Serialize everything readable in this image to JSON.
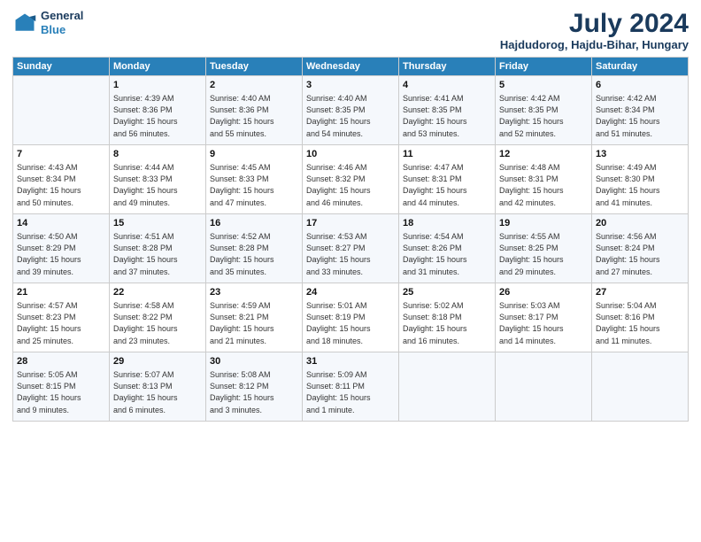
{
  "header": {
    "logo_line1": "General",
    "logo_line2": "Blue",
    "title": "July 2024",
    "subtitle": "Hajdudorog, Hajdu-Bihar, Hungary"
  },
  "days_of_week": [
    "Sunday",
    "Monday",
    "Tuesday",
    "Wednesday",
    "Thursday",
    "Friday",
    "Saturday"
  ],
  "weeks": [
    [
      {
        "day": "",
        "lines": []
      },
      {
        "day": "1",
        "lines": [
          "Sunrise: 4:39 AM",
          "Sunset: 8:36 PM",
          "Daylight: 15 hours",
          "and 56 minutes."
        ]
      },
      {
        "day": "2",
        "lines": [
          "Sunrise: 4:40 AM",
          "Sunset: 8:36 PM",
          "Daylight: 15 hours",
          "and 55 minutes."
        ]
      },
      {
        "day": "3",
        "lines": [
          "Sunrise: 4:40 AM",
          "Sunset: 8:35 PM",
          "Daylight: 15 hours",
          "and 54 minutes."
        ]
      },
      {
        "day": "4",
        "lines": [
          "Sunrise: 4:41 AM",
          "Sunset: 8:35 PM",
          "Daylight: 15 hours",
          "and 53 minutes."
        ]
      },
      {
        "day": "5",
        "lines": [
          "Sunrise: 4:42 AM",
          "Sunset: 8:35 PM",
          "Daylight: 15 hours",
          "and 52 minutes."
        ]
      },
      {
        "day": "6",
        "lines": [
          "Sunrise: 4:42 AM",
          "Sunset: 8:34 PM",
          "Daylight: 15 hours",
          "and 51 minutes."
        ]
      }
    ],
    [
      {
        "day": "7",
        "lines": [
          "Sunrise: 4:43 AM",
          "Sunset: 8:34 PM",
          "Daylight: 15 hours",
          "and 50 minutes."
        ]
      },
      {
        "day": "8",
        "lines": [
          "Sunrise: 4:44 AM",
          "Sunset: 8:33 PM",
          "Daylight: 15 hours",
          "and 49 minutes."
        ]
      },
      {
        "day": "9",
        "lines": [
          "Sunrise: 4:45 AM",
          "Sunset: 8:33 PM",
          "Daylight: 15 hours",
          "and 47 minutes."
        ]
      },
      {
        "day": "10",
        "lines": [
          "Sunrise: 4:46 AM",
          "Sunset: 8:32 PM",
          "Daylight: 15 hours",
          "and 46 minutes."
        ]
      },
      {
        "day": "11",
        "lines": [
          "Sunrise: 4:47 AM",
          "Sunset: 8:31 PM",
          "Daylight: 15 hours",
          "and 44 minutes."
        ]
      },
      {
        "day": "12",
        "lines": [
          "Sunrise: 4:48 AM",
          "Sunset: 8:31 PM",
          "Daylight: 15 hours",
          "and 42 minutes."
        ]
      },
      {
        "day": "13",
        "lines": [
          "Sunrise: 4:49 AM",
          "Sunset: 8:30 PM",
          "Daylight: 15 hours",
          "and 41 minutes."
        ]
      }
    ],
    [
      {
        "day": "14",
        "lines": [
          "Sunrise: 4:50 AM",
          "Sunset: 8:29 PM",
          "Daylight: 15 hours",
          "and 39 minutes."
        ]
      },
      {
        "day": "15",
        "lines": [
          "Sunrise: 4:51 AM",
          "Sunset: 8:28 PM",
          "Daylight: 15 hours",
          "and 37 minutes."
        ]
      },
      {
        "day": "16",
        "lines": [
          "Sunrise: 4:52 AM",
          "Sunset: 8:28 PM",
          "Daylight: 15 hours",
          "and 35 minutes."
        ]
      },
      {
        "day": "17",
        "lines": [
          "Sunrise: 4:53 AM",
          "Sunset: 8:27 PM",
          "Daylight: 15 hours",
          "and 33 minutes."
        ]
      },
      {
        "day": "18",
        "lines": [
          "Sunrise: 4:54 AM",
          "Sunset: 8:26 PM",
          "Daylight: 15 hours",
          "and 31 minutes."
        ]
      },
      {
        "day": "19",
        "lines": [
          "Sunrise: 4:55 AM",
          "Sunset: 8:25 PM",
          "Daylight: 15 hours",
          "and 29 minutes."
        ]
      },
      {
        "day": "20",
        "lines": [
          "Sunrise: 4:56 AM",
          "Sunset: 8:24 PM",
          "Daylight: 15 hours",
          "and 27 minutes."
        ]
      }
    ],
    [
      {
        "day": "21",
        "lines": [
          "Sunrise: 4:57 AM",
          "Sunset: 8:23 PM",
          "Daylight: 15 hours",
          "and 25 minutes."
        ]
      },
      {
        "day": "22",
        "lines": [
          "Sunrise: 4:58 AM",
          "Sunset: 8:22 PM",
          "Daylight: 15 hours",
          "and 23 minutes."
        ]
      },
      {
        "day": "23",
        "lines": [
          "Sunrise: 4:59 AM",
          "Sunset: 8:21 PM",
          "Daylight: 15 hours",
          "and 21 minutes."
        ]
      },
      {
        "day": "24",
        "lines": [
          "Sunrise: 5:01 AM",
          "Sunset: 8:19 PM",
          "Daylight: 15 hours",
          "and 18 minutes."
        ]
      },
      {
        "day": "25",
        "lines": [
          "Sunrise: 5:02 AM",
          "Sunset: 8:18 PM",
          "Daylight: 15 hours",
          "and 16 minutes."
        ]
      },
      {
        "day": "26",
        "lines": [
          "Sunrise: 5:03 AM",
          "Sunset: 8:17 PM",
          "Daylight: 15 hours",
          "and 14 minutes."
        ]
      },
      {
        "day": "27",
        "lines": [
          "Sunrise: 5:04 AM",
          "Sunset: 8:16 PM",
          "Daylight: 15 hours",
          "and 11 minutes."
        ]
      }
    ],
    [
      {
        "day": "28",
        "lines": [
          "Sunrise: 5:05 AM",
          "Sunset: 8:15 PM",
          "Daylight: 15 hours",
          "and 9 minutes."
        ]
      },
      {
        "day": "29",
        "lines": [
          "Sunrise: 5:07 AM",
          "Sunset: 8:13 PM",
          "Daylight: 15 hours",
          "and 6 minutes."
        ]
      },
      {
        "day": "30",
        "lines": [
          "Sunrise: 5:08 AM",
          "Sunset: 8:12 PM",
          "Daylight: 15 hours",
          "and 3 minutes."
        ]
      },
      {
        "day": "31",
        "lines": [
          "Sunrise: 5:09 AM",
          "Sunset: 8:11 PM",
          "Daylight: 15 hours",
          "and 1 minute."
        ]
      },
      {
        "day": "",
        "lines": []
      },
      {
        "day": "",
        "lines": []
      },
      {
        "day": "",
        "lines": []
      }
    ]
  ]
}
